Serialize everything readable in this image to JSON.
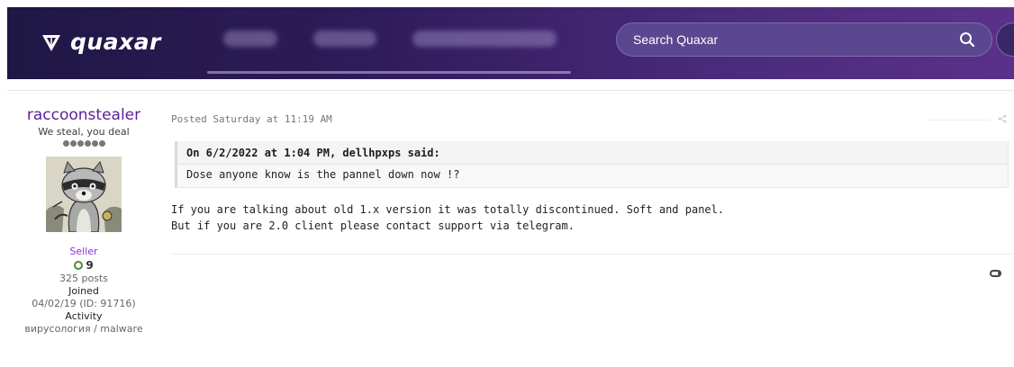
{
  "header": {
    "logo_text": "quaxar",
    "nav": [
      "",
      "",
      ""
    ],
    "search": {
      "placeholder": "Search Quaxar"
    },
    "colors": {
      "bg_start": "#1f1744",
      "bg_end": "#5b3189",
      "search_bg": "#5a4790"
    }
  },
  "author": {
    "username": "raccoonstealer",
    "title": "We steal, you deal",
    "pips": 6,
    "role": "Seller",
    "reputation": "9",
    "posts": "325 posts",
    "joined_label": "Joined",
    "joined_value": "04/02/19 (ID: 91716)",
    "activity_label": "Activity",
    "activity_value": "вирусология / malware",
    "colors": {
      "username": "#5b1f9a",
      "role": "#9133d6"
    }
  },
  "post": {
    "date": "Posted Saturday at 11:19 AM",
    "quote": {
      "header": "On 6/2/2022 at 1:04 PM, dellhpxps said:",
      "body": "Dose anyone know is the pannel down now !?"
    },
    "body_lines": [
      "If you are talking about old 1.x version it was totally discontinued. Soft and panel.",
      "But if you are 2.0 client please contact support via telegram."
    ]
  },
  "icons": [
    "quaxar-logo-icon",
    "search-icon",
    "share-icon",
    "reputation-icon",
    "reaction-icon"
  ]
}
